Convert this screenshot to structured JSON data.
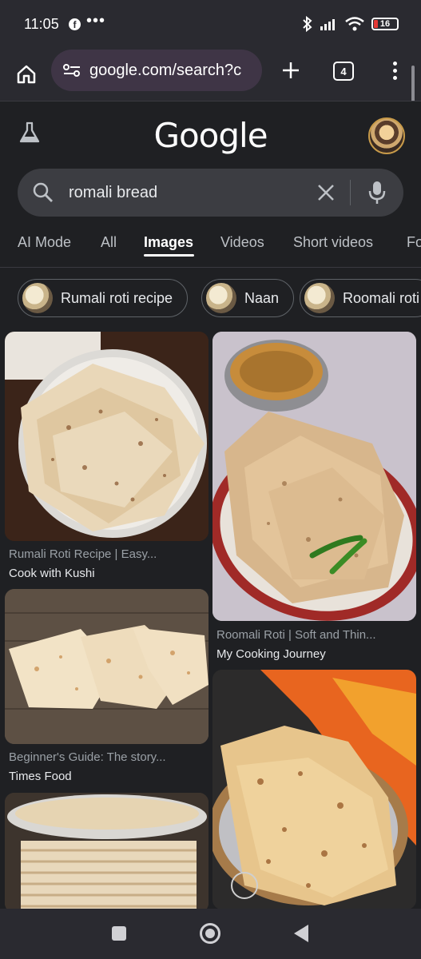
{
  "status_bar": {
    "time": "11:05",
    "more": "•••",
    "battery": "16",
    "notification_icon": "facebook-icon"
  },
  "browser": {
    "url": "google.com/search?c",
    "tab_count": "4"
  },
  "google": {
    "logo": "Google",
    "search_query": "romali bread"
  },
  "tabs": [
    {
      "label": "AI Mode",
      "active": false
    },
    {
      "label": "All",
      "active": false
    },
    {
      "label": "Images",
      "active": true
    },
    {
      "label": "Videos",
      "active": false
    },
    {
      "label": "Short videos",
      "active": false
    },
    {
      "label": "Fo",
      "active": false
    }
  ],
  "chips": [
    {
      "label": "Rumali roti recipe"
    },
    {
      "label": "Naan"
    },
    {
      "label": "Roomali roti"
    }
  ],
  "results": [
    {
      "title": "Rumali Roti Recipe | Easy...",
      "source": "Cook with Kushi"
    },
    {
      "title": "Roomali Roti | Soft and Thin...",
      "source": "My Cooking Journey"
    },
    {
      "title": "Beginner's Guide: The story...",
      "source": "Times Food"
    },
    {
      "title": "",
      "source": ""
    },
    {
      "title": "",
      "source": ""
    }
  ],
  "colors": {
    "background": "#1f2023",
    "url_pill": "#3f3546",
    "search_box": "#3c3d42"
  }
}
